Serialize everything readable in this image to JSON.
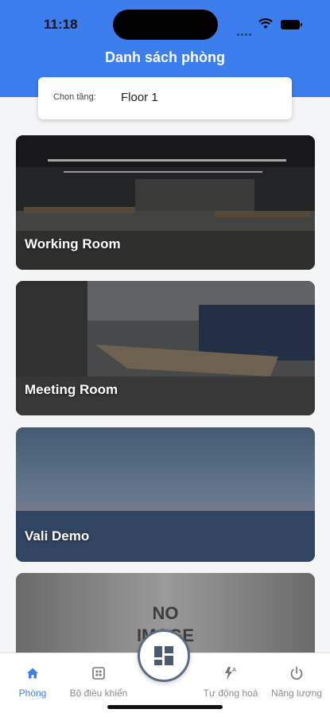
{
  "status": {
    "time": "11:18"
  },
  "header": {
    "title": "Danh sách phòng"
  },
  "floor": {
    "label": "Chọn tầng:",
    "value": "Floor 1"
  },
  "rooms": [
    {
      "name": "Working Room"
    },
    {
      "name": "Meeting Room"
    },
    {
      "name": "Vali Demo"
    },
    {
      "placeholder_line1": "NO",
      "placeholder_line2": "IMAGE"
    }
  ],
  "tabs": [
    {
      "label": "Phòng",
      "icon": "home-icon"
    },
    {
      "label": "Bộ điều khiển",
      "icon": "controller-icon"
    },
    {
      "label": "Tự động hoá",
      "icon": "automation-icon"
    },
    {
      "label": "Năng lượng",
      "icon": "power-icon"
    }
  ],
  "center_button": {
    "icon": "dashboard-icon"
  },
  "colors": {
    "accent": "#3d7eee",
    "inactive": "#8a8a8a"
  }
}
